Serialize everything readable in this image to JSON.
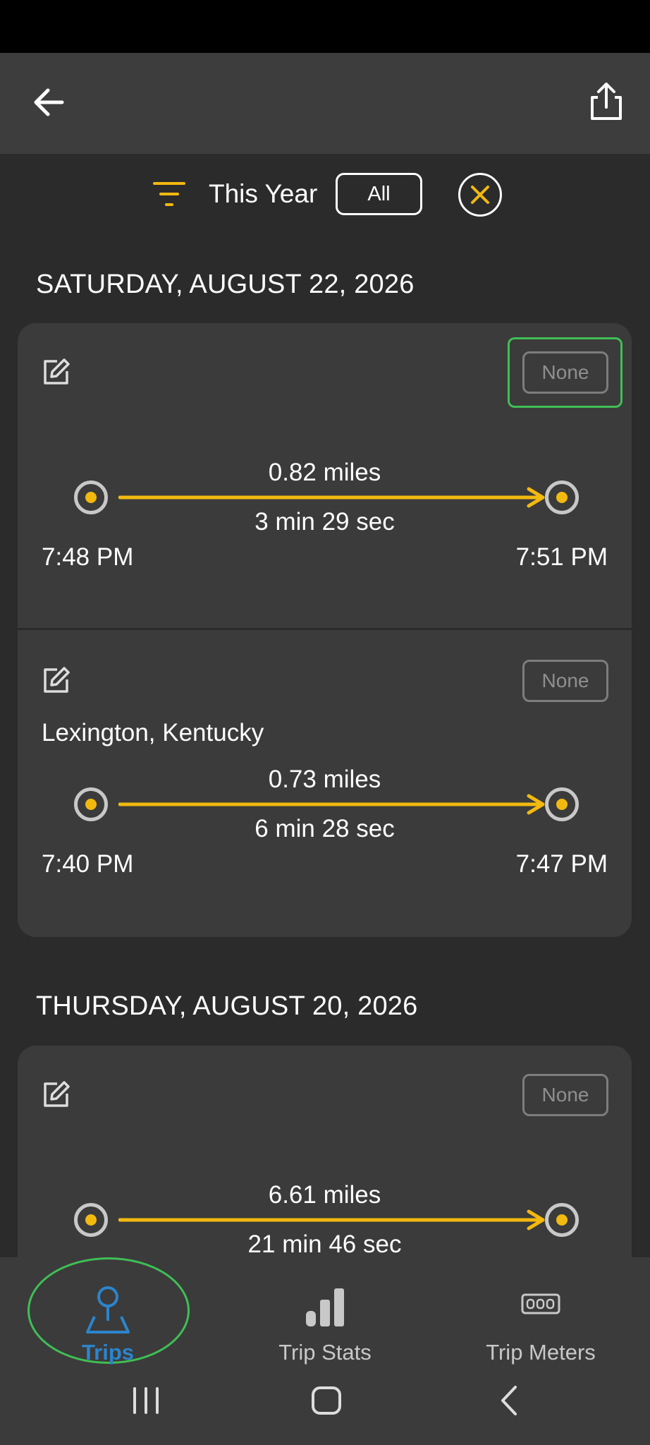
{
  "header": {
    "back_icon": "arrow-left-icon",
    "share_icon": "share-icon"
  },
  "filter": {
    "icon": "filter-icon",
    "period_label": "This Year",
    "category_button": "All",
    "clear_icon": "close-circle-icon",
    "accent_color": "#f2b90f"
  },
  "groups": [
    {
      "date": "SATURDAY, AUGUST 22, 2026",
      "trips": [
        {
          "category": "None",
          "location": "",
          "distance": "0.82 miles",
          "duration": "3 min 29 sec",
          "start_time": "7:48 PM",
          "end_time": "7:51 PM"
        },
        {
          "category": "None",
          "location": "Lexington, Kentucky",
          "distance": "0.73 miles",
          "duration": "6 min 28 sec",
          "start_time": "7:40 PM",
          "end_time": "7:47 PM"
        }
      ]
    },
    {
      "date": "THURSDAY, AUGUST 20, 2026",
      "trips": [
        {
          "category": "None",
          "location": "",
          "distance": "6.61 miles",
          "duration": "21 min 46 sec",
          "start_time": "",
          "end_time": ""
        }
      ]
    }
  ],
  "bottom_nav": {
    "items": [
      {
        "label": "Trips",
        "icon": "map-pin-icon",
        "active": true
      },
      {
        "label": "Trip Stats",
        "icon": "bar-chart-icon",
        "active": false
      },
      {
        "label": "Trip Meters",
        "icon": "odometer-icon",
        "active": false
      }
    ],
    "active_color": "#2c84cc",
    "highlight_color": "#3fbf55"
  },
  "system_nav": {
    "recents_icon": "recents-icon",
    "home_icon": "home-icon",
    "back_icon": "system-back-icon"
  }
}
